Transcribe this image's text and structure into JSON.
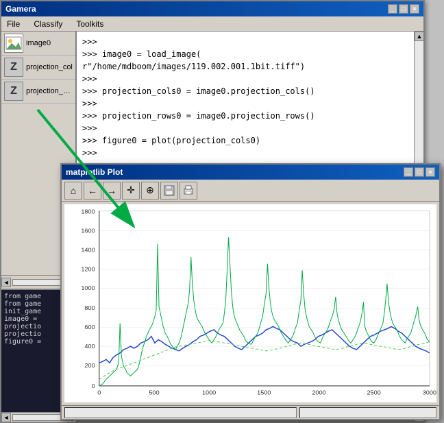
{
  "app": {
    "title": "Gamera",
    "menu": [
      "File",
      "Classify",
      "Toolkits"
    ]
  },
  "sidebar": {
    "items": [
      {
        "id": "image0",
        "label": "image0",
        "icon": "img"
      },
      {
        "id": "projection_cols",
        "label": "projection_col",
        "icon": "Z"
      },
      {
        "id": "projection_rows",
        "label": "projection_row",
        "icon": "Z"
      }
    ],
    "code_history": [
      "from game",
      "from game",
      "init_game",
      "image0 =",
      "projectio",
      "projectio",
      "figure0 ="
    ]
  },
  "console": {
    "lines": [
      ">>>",
      ">>> image0 = load_image(",
      "r\"/home/mdboom/images/119.002.001.1bit.tiff\")",
      ">>>",
      ">>> projection_cols0 = image0.projection_cols()",
      ">>>",
      ">>> projection_rows0 = image0.projection_rows()",
      ">>>",
      ">>> figure0 = plot(projection_cols0)",
      ">>>"
    ]
  },
  "matplotlib": {
    "title": "matplotlib Plot",
    "toolbar_buttons": [
      {
        "name": "home",
        "icon": "⌂"
      },
      {
        "name": "back",
        "icon": "←"
      },
      {
        "name": "forward",
        "icon": "→"
      },
      {
        "name": "pan",
        "icon": "✛"
      },
      {
        "name": "zoom",
        "icon": "🔍"
      },
      {
        "name": "save",
        "icon": "💾"
      },
      {
        "name": "print",
        "icon": "🖨"
      }
    ],
    "plot": {
      "y_axis": [
        0,
        200,
        400,
        600,
        800,
        1000,
        1200,
        1400,
        1600,
        1800
      ],
      "x_axis": [
        0,
        500,
        1000,
        1500,
        2000,
        2500,
        3000
      ]
    },
    "status_left": "",
    "status_right": ""
  },
  "arrow": {
    "color": "#00aa44",
    "label": ""
  }
}
